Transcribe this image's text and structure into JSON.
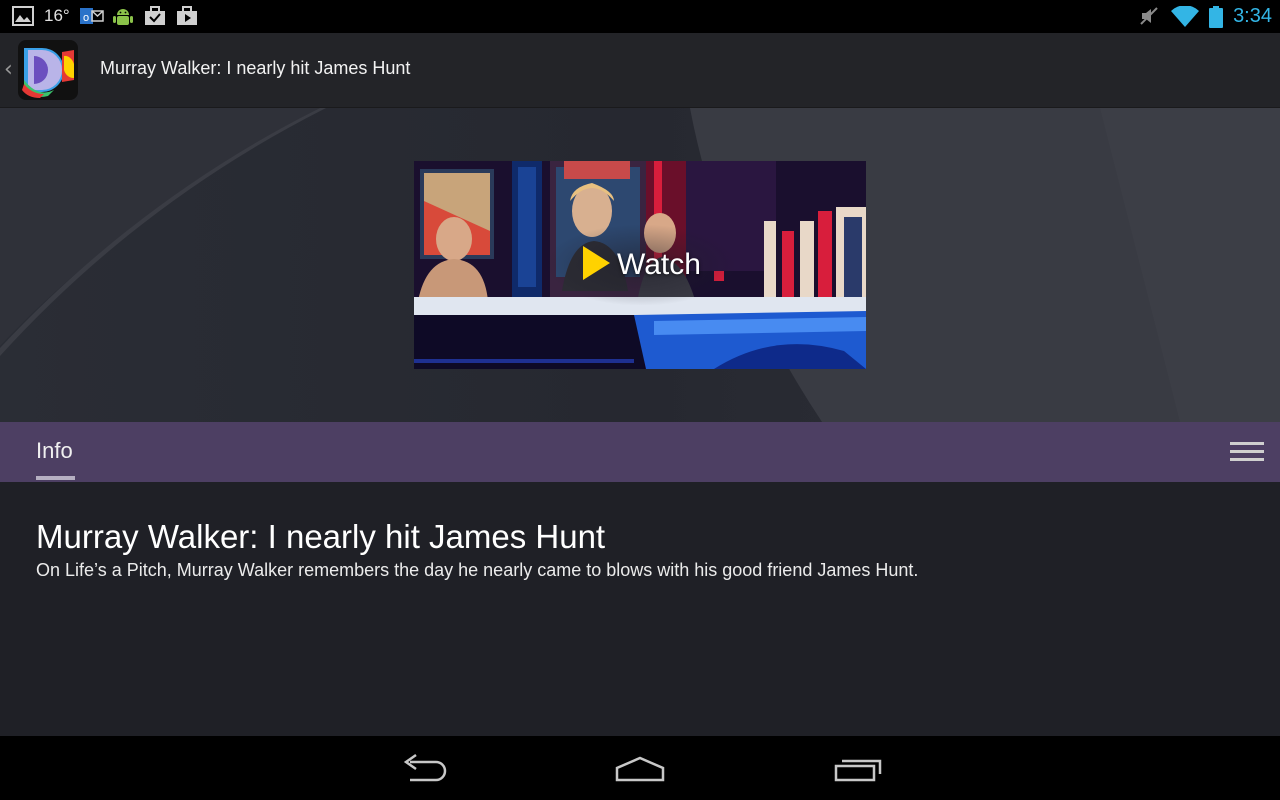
{
  "status_bar": {
    "temperature": "16°",
    "time": "3:34"
  },
  "action_bar": {
    "title": "Murray Walker: I nearly hit James Hunt",
    "up_glyph": "‹"
  },
  "hero": {
    "watch_label": "Watch"
  },
  "tabs": [
    {
      "label": "Info",
      "selected": true
    }
  ],
  "content": {
    "title": "Murray Walker: I nearly hit James Hunt",
    "description": "On Life’s a Pitch, Murray Walker remembers the day he nearly came to blows with his good friend James Hunt."
  },
  "colors": {
    "status_accent": "#33b5e5",
    "tab_bar": "#4d3f63",
    "play_yellow": "#ffd200",
    "content_bg": "#1f2026"
  },
  "icons": {
    "status_left": [
      "gallery-icon",
      "outlook-icon",
      "android-icon",
      "briefcase-icon",
      "play-store-icon"
    ],
    "status_right": [
      "mute-icon",
      "wifi-icon",
      "battery-icon"
    ],
    "nav": [
      "back-icon",
      "home-icon",
      "recent-apps-icon"
    ]
  }
}
